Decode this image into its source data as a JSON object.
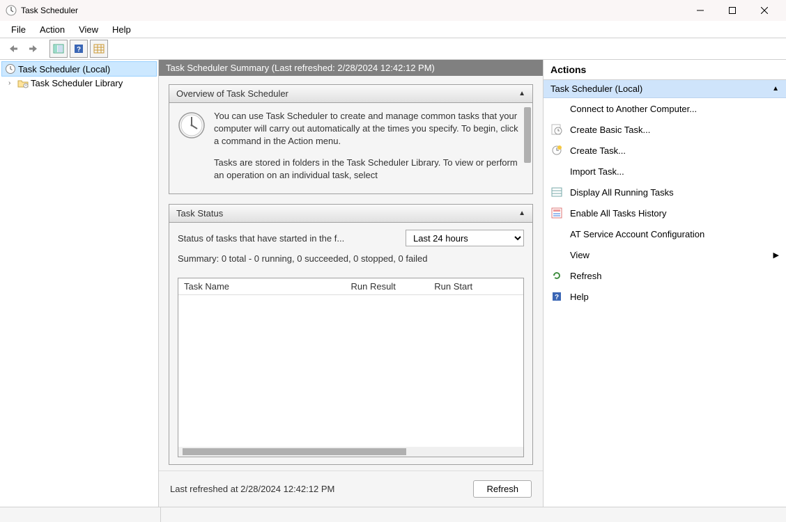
{
  "window": {
    "title": "Task Scheduler"
  },
  "menubar": {
    "items": [
      "File",
      "Action",
      "View",
      "Help"
    ]
  },
  "tree": {
    "root": {
      "label": "Task Scheduler (Local)"
    },
    "lib": {
      "label": "Task Scheduler Library"
    }
  },
  "center": {
    "header": "Task Scheduler Summary (Last refreshed: 2/28/2024 12:42:12 PM)",
    "overview": {
      "title": "Overview of Task Scheduler",
      "p1": "You can use Task Scheduler to create and manage common tasks that your computer will carry out automatically at the times you specify. To begin, click a command in the Action menu.",
      "p2": "Tasks are stored in folders in the Task Scheduler Library. To view or perform an operation on an individual task, select"
    },
    "status": {
      "title": "Task Status",
      "label": "Status of tasks that have started in the f...",
      "select_value": "Last 24 hours",
      "summary": "Summary: 0 total - 0 running, 0 succeeded, 0 stopped, 0 failed",
      "columns": [
        "Task Name",
        "Run Result",
        "Run Start"
      ]
    },
    "footer": {
      "timestamp": "Last refreshed at 2/28/2024 12:42:12 PM",
      "refresh": "Refresh"
    }
  },
  "actions": {
    "title": "Actions",
    "subtitle": "Task Scheduler (Local)",
    "items": [
      {
        "label": "Connect to Another Computer...",
        "icon": "none"
      },
      {
        "label": "Create Basic Task...",
        "icon": "clock-basic"
      },
      {
        "label": "Create Task...",
        "icon": "clock-create"
      },
      {
        "label": "Import Task...",
        "icon": "none"
      },
      {
        "label": "Display All Running Tasks",
        "icon": "display"
      },
      {
        "label": "Enable All Tasks History",
        "icon": "history"
      },
      {
        "label": "AT Service Account Configuration",
        "icon": "none"
      },
      {
        "label": "View",
        "icon": "none",
        "submenu": true
      },
      {
        "label": "Refresh",
        "icon": "refresh"
      },
      {
        "label": "Help",
        "icon": "help"
      }
    ]
  }
}
